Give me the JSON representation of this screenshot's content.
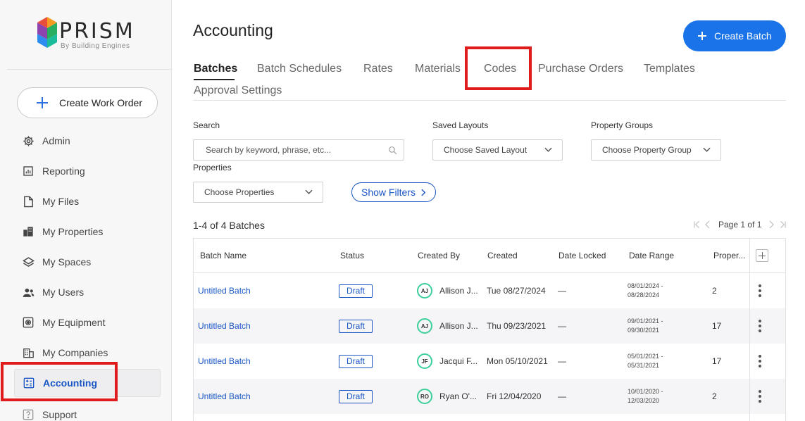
{
  "app": {
    "logo_text": "PRISM",
    "logo_tagline": "By Building Engines",
    "accent_color": "#1a73e8",
    "highlight_color": "#e01b1b"
  },
  "sidebar": {
    "create_work_order_label": "Create Work Order",
    "items": [
      {
        "label": "Admin",
        "icon": "gear-icon"
      },
      {
        "label": "Reporting",
        "icon": "bar-chart-icon"
      },
      {
        "label": "My Files",
        "icon": "file-icon"
      },
      {
        "label": "My Properties",
        "icon": "building-icon"
      },
      {
        "label": "My Spaces",
        "icon": "layers-icon"
      },
      {
        "label": "My Users",
        "icon": "users-icon"
      },
      {
        "label": "My Equipment",
        "icon": "equipment-icon"
      },
      {
        "label": "My Companies",
        "icon": "companies-icon"
      },
      {
        "label": "Accounting",
        "icon": "calculator-icon",
        "active": true
      },
      {
        "label": "Support",
        "icon": "help-icon"
      }
    ]
  },
  "header": {
    "title": "Accounting",
    "create_batch_label": "Create Batch"
  },
  "tabs": [
    {
      "label": "Batches",
      "active": true
    },
    {
      "label": "Batch Schedules"
    },
    {
      "label": "Rates"
    },
    {
      "label": "Materials"
    },
    {
      "label": "Codes",
      "highlighted": true
    },
    {
      "label": "Purchase Orders"
    },
    {
      "label": "Templates"
    },
    {
      "label": "Approval Settings"
    }
  ],
  "filters": {
    "search_label": "Search",
    "search_placeholder": "Search by keyword, phrase, etc...",
    "saved_layouts_label": "Saved Layouts",
    "saved_layouts_value": "Choose Saved Layout",
    "property_groups_label": "Property Groups",
    "property_groups_value": "Choose Property Group",
    "properties_label": "Properties",
    "properties_value": "Choose Properties",
    "show_filters_label": "Show Filters"
  },
  "results": {
    "count_text": "1-4 of 4 Batches",
    "page_text": "Page 1 of 1"
  },
  "table": {
    "columns": [
      "Batch Name",
      "Status",
      "Created By",
      "Created",
      "Date Locked",
      "Date Range",
      "Proper..."
    ],
    "rows": [
      {
        "name": "Untitled Batch",
        "status": "Draft",
        "initials": "AJ",
        "created_by": "Allison J...",
        "created": "Tue 08/27/2024",
        "date_locked": "—",
        "range_start": "08/01/2024 -",
        "range_end": "08/28/2024",
        "properties": "2"
      },
      {
        "name": "Untitled Batch",
        "status": "Draft",
        "initials": "AJ",
        "created_by": "Allison J...",
        "created": "Thu 09/23/2021",
        "date_locked": "—",
        "range_start": "09/01/2021 -",
        "range_end": "09/30/2021",
        "properties": "17"
      },
      {
        "name": "Untitled Batch",
        "status": "Draft",
        "initials": "JF",
        "created_by": "Jacqui F...",
        "created": "Mon 05/10/2021",
        "date_locked": "—",
        "range_start": "05/01/2021 -",
        "range_end": "05/31/2021",
        "properties": "17"
      },
      {
        "name": "Untitled Batch",
        "status": "Draft",
        "initials": "RO",
        "created_by": "Ryan O'...",
        "created": "Fri 12/04/2020",
        "date_locked": "—",
        "range_start": "10/01/2020 -",
        "range_end": "12/03/2020",
        "properties": "2"
      }
    ]
  }
}
